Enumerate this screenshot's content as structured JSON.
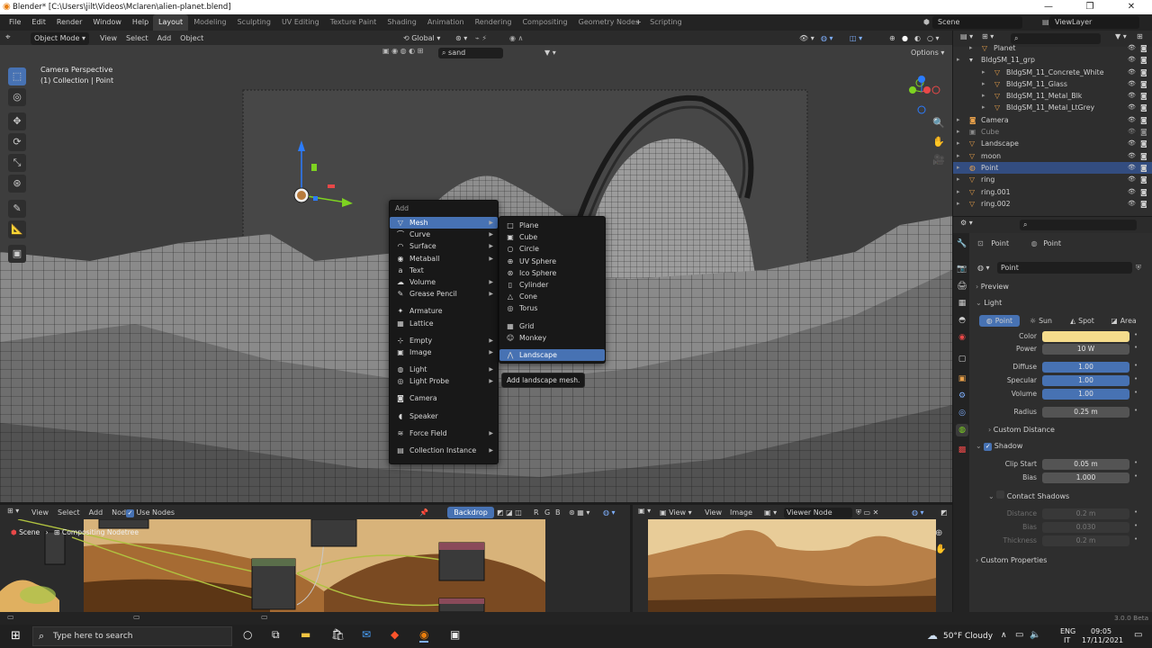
{
  "window": {
    "title": "Blender* [C:\\Users\\jilt\\Videos\\Mclaren\\alien-planet.blend]"
  },
  "menubar": {
    "items": [
      "File",
      "Edit",
      "Render",
      "Window",
      "Help"
    ],
    "workspaces": [
      "Layout",
      "Modeling",
      "Sculpting",
      "UV Editing",
      "Texture Paint",
      "Shading",
      "Animation",
      "Rendering",
      "Compositing",
      "Geometry Nodes",
      "Scripting"
    ],
    "active_workspace": "Layout",
    "scene": "Scene",
    "view_layer": "ViewLayer"
  },
  "viewport_header": {
    "mode": "Object Mode",
    "menus": [
      "View",
      "Select",
      "Add",
      "Object"
    ],
    "transform_orientation": "Global",
    "search_value": "sand",
    "options": "Options"
  },
  "viewport": {
    "title": "Camera Perspective",
    "subtitle": "(1) Collection | Point"
  },
  "add_menu": {
    "title": "Add",
    "items": [
      {
        "label": "Mesh",
        "icon": "▽",
        "sub": true,
        "highlight": true
      },
      {
        "label": "Curve",
        "icon": "⌒",
        "sub": true
      },
      {
        "label": "Surface",
        "icon": "◠",
        "sub": true
      },
      {
        "label": "Metaball",
        "icon": "◉",
        "sub": true
      },
      {
        "label": "Text",
        "icon": "a",
        "sub": false
      },
      {
        "label": "Volume",
        "icon": "☁",
        "sub": true
      },
      {
        "label": "Grease Pencil",
        "icon": "✎",
        "sub": true
      },
      {
        "sep": true
      },
      {
        "label": "Armature",
        "icon": "✦",
        "sub": false
      },
      {
        "label": "Lattice",
        "icon": "▦",
        "sub": false
      },
      {
        "sep": true
      },
      {
        "label": "Empty",
        "icon": "⊹",
        "sub": true
      },
      {
        "label": "Image",
        "icon": "▣",
        "sub": true
      },
      {
        "sep": true
      },
      {
        "label": "Light",
        "icon": "◍",
        "sub": true
      },
      {
        "label": "Light Probe",
        "icon": "◎",
        "sub": true
      },
      {
        "sep": true
      },
      {
        "label": "Camera",
        "icon": "◙",
        "sub": false
      },
      {
        "sep": true
      },
      {
        "label": "Speaker",
        "icon": "◖",
        "sub": false
      },
      {
        "sep": true
      },
      {
        "label": "Force Field",
        "icon": "≋",
        "sub": true
      },
      {
        "sep": true
      },
      {
        "label": "Collection Instance",
        "icon": "▤",
        "sub": true
      }
    ]
  },
  "mesh_menu": {
    "items": [
      {
        "label": "Plane",
        "icon": "□"
      },
      {
        "label": "Cube",
        "icon": "▣"
      },
      {
        "label": "Circle",
        "icon": "○"
      },
      {
        "label": "UV Sphere",
        "icon": "⊕"
      },
      {
        "label": "Ico Sphere",
        "icon": "⊛"
      },
      {
        "label": "Cylinder",
        "icon": "▯"
      },
      {
        "label": "Cone",
        "icon": "△"
      },
      {
        "label": "Torus",
        "icon": "◎"
      },
      {
        "sep": true
      },
      {
        "label": "Grid",
        "icon": "▦"
      },
      {
        "label": "Monkey",
        "icon": "☺"
      },
      {
        "sep": true
      },
      {
        "label": "Landscape",
        "icon": "⋀",
        "highlight": true
      }
    ],
    "tooltip": "Add landscape mesh."
  },
  "outliner": {
    "rows": [
      {
        "label": "Planet",
        "indent": 1,
        "icon": "▽",
        "icon_color": "#e8a04a"
      },
      {
        "label": "BldgSM_11_grp",
        "indent": 0,
        "icon": "▾",
        "icon_color": "#cfcfcf"
      },
      {
        "label": "BldgSM_11_Concrete_White",
        "indent": 2,
        "icon": "▽",
        "icon_color": "#e8a04a"
      },
      {
        "label": "BldgSM_11_Glass",
        "indent": 2,
        "icon": "▽",
        "icon_color": "#e8a04a"
      },
      {
        "label": "BldgSM_11_Metal_Blk",
        "indent": 2,
        "icon": "▽",
        "icon_color": "#e8a04a"
      },
      {
        "label": "BldgSM_11_Metal_LtGrey",
        "indent": 2,
        "icon": "▽",
        "icon_color": "#e8a04a"
      },
      {
        "label": "Camera",
        "indent": 0,
        "icon": "◙",
        "icon_color": "#e8a04a"
      },
      {
        "label": "Cube",
        "indent": 0,
        "icon": "▣",
        "icon_color": "#8a8a8a",
        "dim": true
      },
      {
        "label": "Landscape",
        "indent": 0,
        "icon": "▽",
        "icon_color": "#e8a04a"
      },
      {
        "label": "moon",
        "indent": 0,
        "icon": "▽",
        "icon_color": "#e8a04a"
      },
      {
        "label": "Point",
        "indent": 0,
        "icon": "◍",
        "icon_color": "#e8a04a",
        "selected": true
      },
      {
        "label": "ring",
        "indent": 0,
        "icon": "▽",
        "icon_color": "#e8a04a"
      },
      {
        "label": "ring.001",
        "indent": 0,
        "icon": "▽",
        "icon_color": "#e8a04a"
      },
      {
        "label": "ring.002",
        "indent": 0,
        "icon": "▽",
        "icon_color": "#e8a04a"
      }
    ]
  },
  "properties": {
    "object_name": "Point",
    "data_name": "Point",
    "datablock": "Point",
    "preview": "Preview",
    "light_section": "Light",
    "light_types": [
      "Point",
      "Sun",
      "Spot",
      "Area"
    ],
    "active_light_type": "Point",
    "color_label": "Color",
    "color_value": "#f5dc8c",
    "fields": [
      {
        "label": "Power",
        "value": "10 W",
        "blue": false
      },
      {
        "label": "Diffuse",
        "value": "1.00",
        "blue": true
      },
      {
        "label": "Specular",
        "value": "1.00",
        "blue": true
      },
      {
        "label": "Volume",
        "value": "1.00",
        "blue": true
      },
      {
        "label": "Radius",
        "value": "0.25 m",
        "blue": false
      }
    ],
    "custom_distance": "Custom Distance",
    "shadow": "Shadow",
    "shadow_fields": [
      {
        "label": "Clip Start",
        "value": "0.05 m"
      },
      {
        "label": "Bias",
        "value": "1.000"
      }
    ],
    "contact_shadows": "Contact Shadows",
    "contact_fields": [
      {
        "label": "Distance",
        "value": "0.2 m"
      },
      {
        "label": "Bias",
        "value": "0.030"
      },
      {
        "label": "Thickness",
        "value": "0.2 m"
      }
    ],
    "custom_properties": "Custom Properties"
  },
  "node_editor": {
    "menus": [
      "View",
      "Select",
      "Add",
      "Node"
    ],
    "use_nodes": "Use Nodes",
    "backdrop": "Backdrop",
    "channels": [
      "R",
      "G",
      "B"
    ],
    "breadcrumb_scene": "Scene",
    "breadcrumb_tree": "Compositing Nodetree"
  },
  "image_editor": {
    "menus": [
      "View",
      "View",
      "Image"
    ],
    "image": "Viewer Node"
  },
  "version": "3.0.0 Beta",
  "taskbar": {
    "search_placeholder": "Type here to search",
    "weather": "50°F  Cloudy",
    "lang1": "ENG",
    "lang2": "IT",
    "time": "09:05",
    "date": "17/11/2021"
  }
}
